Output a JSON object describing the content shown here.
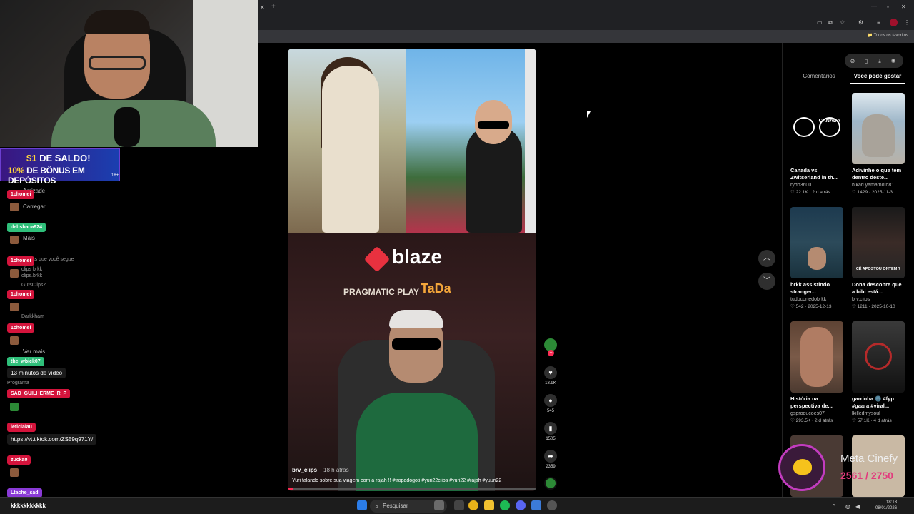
{
  "promo": {
    "line1_amount": "$1",
    "line1_rest": " DE SALDO!",
    "line2_pct": "10%",
    "line2_rest": " DE BÔNUS EM DEPÓSITOS",
    "age": "18+"
  },
  "bookmarks": {
    "all_label": "Todos os favoritos"
  },
  "video": {
    "brand_logo": "blaze",
    "sponsor_1": "PRAGMATIC PLAY",
    "sponsor_2": "TaDa",
    "username": "brv_clips",
    "posted": "· 18 h atrás",
    "caption": "Yuri falando sobre sua viagem com a rajah !! #tropadogoti #yuri22clips #yuri22 #rajah #yuuri22",
    "progress_fraction": 0.02
  },
  "actions": {
    "likes": "18.9K",
    "comments": "545",
    "saves": "1505",
    "shares": "2359"
  },
  "right_panel": {
    "tab_comments": "Comentários",
    "tab_you_may_like": "Você pode gostar",
    "cards": [
      {
        "title": "Canada vs Zwitserland in th...",
        "author": "rydo3600",
        "meta": "♡ 22.1K · 2 d atrás",
        "color": "#000000",
        "thumb_text": "CANADA"
      },
      {
        "title": "Adivinhe o que tem dentro deste...",
        "author": "hikari.yamamoto81",
        "meta": "♡ 1429 · 2025-11-3",
        "color": "#9fb7c9",
        "thumb_text": ""
      },
      {
        "title": "brkk assistindo stranger...",
        "author": "tudocortedobrkk",
        "meta": "♡ 542 · 2025-12-13",
        "color": "#1d3a4f",
        "thumb_text": ""
      },
      {
        "title": "Dona descobre que a bibi está...",
        "author": "brv.clips",
        "meta": "♡ 1211 · 2025-10-10",
        "color": "#3a2b27",
        "thumb_text": "CÊ APOSTOU ONTEM ?"
      },
      {
        "title": "História na perspectiva de...",
        "author": "gsproducoes07",
        "meta": "♡ 293.5K · 2 d atrás",
        "color": "#7a5a48",
        "thumb_text": ""
      },
      {
        "title": "garrinha 🌚 #fyp #gaara #viral...",
        "author": "lkilledmysoul",
        "meta": "♡ 57.1K · 4 d atrás",
        "color": "#2b2b2b",
        "thumb_text": ""
      }
    ]
  },
  "chat": {
    "names": [
      "1chomei",
      "debsbaca924",
      "1chomei",
      "1chomei",
      "1chomei",
      "the_wbick07",
      "SAD_GUILHERME_R_P",
      "leticialau",
      "zucka0",
      "Ltache_sad"
    ],
    "messages": [
      "13 minutos de vídeo",
      "https://vt.tiktok.com/ZS59q971Y/",
      "kkkkkkkkkkk"
    ],
    "ghost_items": [
      "Amizade",
      "Carregar",
      "Mais",
      "Contas que você segue",
      "clips brkk",
      "clips.brkk",
      "GutsClipsZ",
      "Darkkham",
      "Ver mais",
      "Programa"
    ]
  },
  "taskbar": {
    "search_placeholder": "Pesquisar",
    "time": "18:13",
    "date": "08/01/2026"
  },
  "overlay": {
    "label": "Meta Cinefy",
    "current": "2561",
    "goal": "2750"
  },
  "colors": {
    "tiktok_red": "#fe2c55",
    "chat_name_red": "#d4143c",
    "chat_name_green": "#2fbf7a",
    "chat_name_purple": "#8a3ad6"
  }
}
